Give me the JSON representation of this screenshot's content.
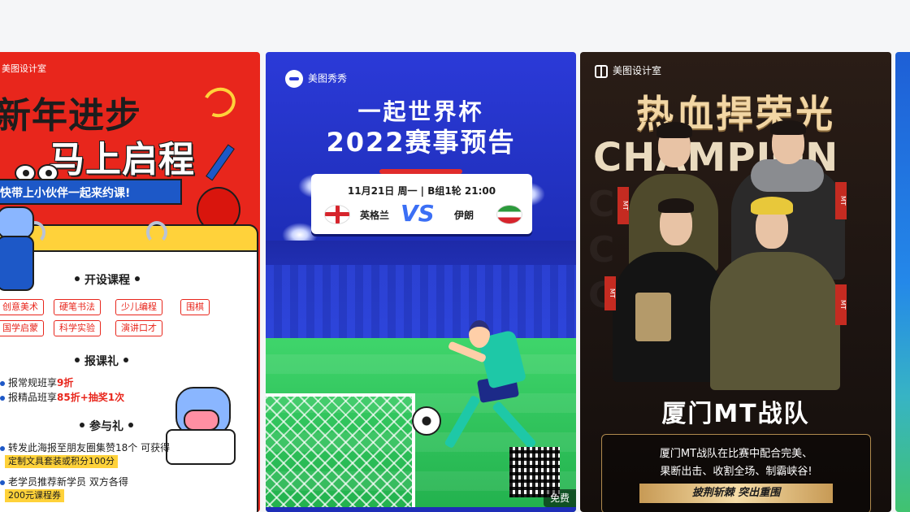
{
  "cards": [
    {
      "brand": "美图设计室",
      "headline_1": "新年进步",
      "headline_2": "马上启程",
      "banner": "快带上小伙伴一起来约课!",
      "section_courses": "开设课程",
      "courses": [
        "创意美术",
        "硬笔书法",
        "少儿编程",
        "围棋",
        "国学启蒙",
        "科学实验",
        "演讲口才"
      ],
      "section_gift": "报课礼",
      "gift_lines": [
        {
          "text": "报常规班享",
          "highlight": "9折"
        },
        {
          "text": "报精品班享",
          "highlight": "85折+抽奖1次"
        }
      ],
      "section_join": "参与礼",
      "join_line_1": "转发此海报至朋友圈集赞18个 可获得",
      "join_coupon_1": "定制文具套装或积分100分",
      "join_line_2": "老学员推荐新学员 双方各得",
      "join_coupon_2": "200元课程券"
    },
    {
      "brand": "美图秀秀",
      "title_1": "一起世界杯",
      "title_2": "2022赛事预告",
      "match_date": "11月21日 周一 | B组1轮 21:00",
      "team_home": "英格兰",
      "vs": "VS",
      "team_away": "伊朗",
      "badge": "免费"
    },
    {
      "brand": "美图设计室",
      "title": "热血捍荣光",
      "subtitle": "CHAMPION",
      "team_name": "厦门MT战队",
      "desc_1": "厦门MT战队在比赛中配合完美、",
      "desc_2": "果断出击、收割全场、制霸峡谷!",
      "slogan": "披荆斩棘 突出重围"
    }
  ]
}
